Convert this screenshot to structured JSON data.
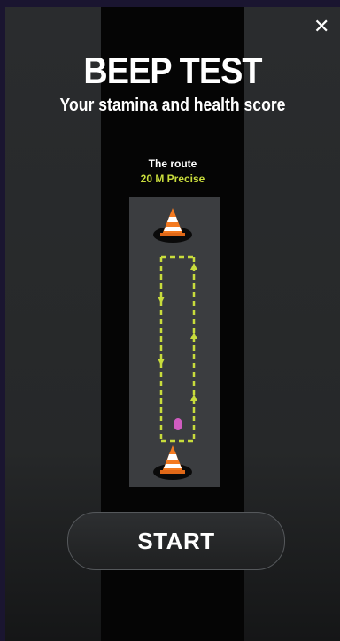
{
  "header": {
    "close_icon": "close-icon"
  },
  "title": "BEEP TEST",
  "subtitle": "Your stamina and health score",
  "route": {
    "label": "The route",
    "value": "20 M Precise"
  },
  "colors": {
    "accent": "#c8dc3c",
    "runner": "#d05cc0",
    "cone": "#f47a20"
  },
  "start_label": "START"
}
